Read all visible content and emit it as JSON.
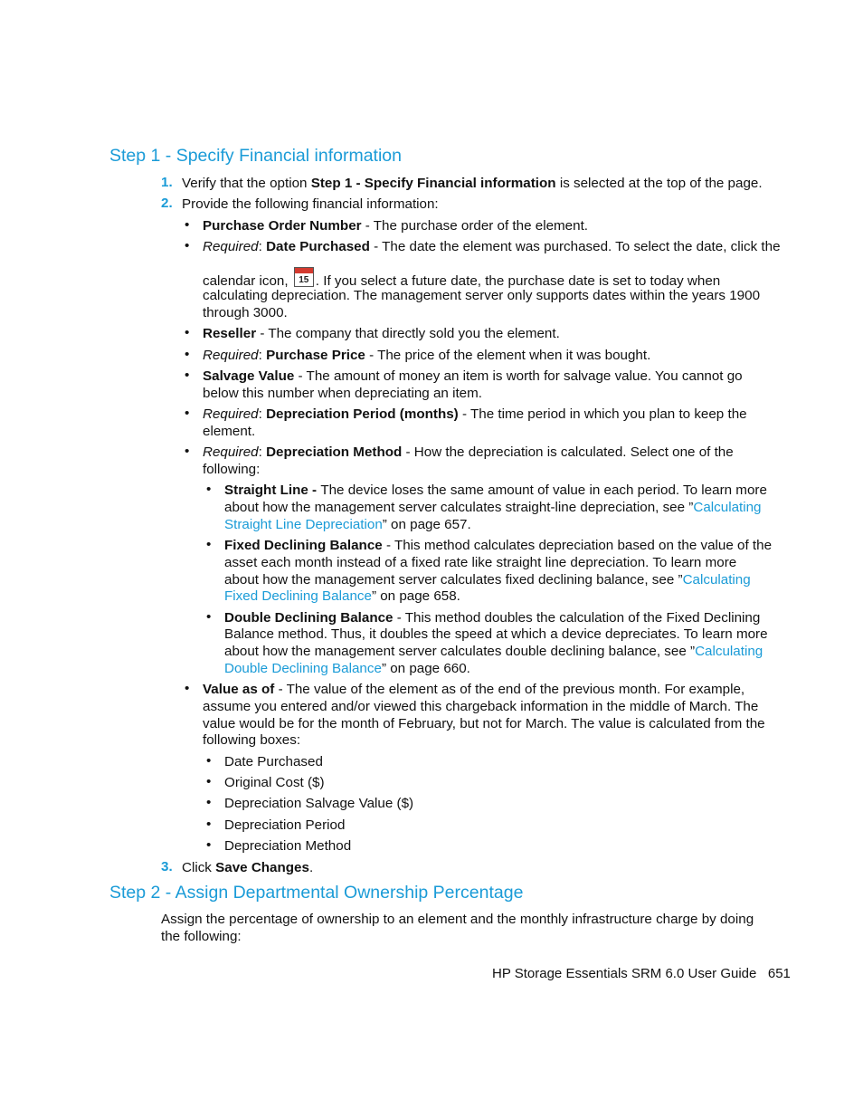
{
  "step1": {
    "heading": "Step 1 - Specify Financial information",
    "items": [
      {
        "num": "1.",
        "pre": "Verify that the option ",
        "bold": "Step 1 - Specify Financial information",
        "post": " is selected at the top of the page."
      },
      {
        "num": "2.",
        "text": "Provide the following financial information:"
      }
    ],
    "fields": {
      "po": {
        "bold": "Purchase Order Number",
        "text": " - The purchase order of the element."
      },
      "date": {
        "req": "Required",
        "bold": "Date Purchased",
        "text1": " - The date the element was purchased. To select the date, click the",
        "text2a": "calendar icon, ",
        "icon_day": "15",
        "text2b": ". If you select a future date, the purchase date is set to today when",
        "text3": "calculating depreciation. The management server only supports dates within the years 1900",
        "text4": "through 3000."
      },
      "reseller": {
        "bold": "Reseller",
        "text": " - The company that directly sold you the element."
      },
      "price": {
        "req": "Required",
        "bold": "Purchase Price",
        "text": " - The price of the element when it was bought."
      },
      "salvage": {
        "bold": "Salvage Value",
        "text1": " - The amount of money an item is worth for salvage value. You cannot go",
        "text2": "below this number when depreciating an item."
      },
      "period": {
        "req": "Required",
        "bold": "Depreciation Period (months)",
        "text1": " - The time period in which you plan to keep the",
        "text2": "element."
      },
      "method": {
        "req": "Required",
        "bold": "Depreciation Method",
        "text1": " - How the depreciation is calculated. Select one of the",
        "text2": "following:"
      }
    },
    "methods": {
      "straight": {
        "bold": "Straight Line - ",
        "l1": "The device loses the same amount of value in each period. To learn more",
        "l2a": "about how the management server calculates straight-line depreciation, see ”",
        "l2link": "Calculating",
        "l3link": "Straight Line Depreciation",
        "l3post": "” on page 657."
      },
      "fixed": {
        "bold": "Fixed Declining Balance",
        "l1": " - This method calculates depreciation based on the value of the",
        "l2": "asset each month instead of a fixed rate like straight line depreciation. To learn more",
        "l3a": "about how the management server calculates fixed declining balance, see ”",
        "l3link": "Calculating",
        "l4link": "Fixed Declining Balance",
        "l4post": "” on page 658."
      },
      "double": {
        "bold": "Double Declining Balance",
        "l1": " - This method doubles the calculation of the Fixed Declining",
        "l2": "Balance method. Thus, it doubles the speed at which a device depreciates. To learn more",
        "l3a": "about how the management server calculates double declining balance, see ”",
        "l3link": "Calculating",
        "l4link": "Double Declining Balance",
        "l4post": "” on page 660."
      }
    },
    "value_as_of": {
      "bold": "Value as of",
      "l1": " - The value of the element as of the end of the previous month. For example,",
      "l2": "assume you entered and/or viewed this chargeback information in the middle of March. The",
      "l3": "value would be for the month of February, but not for March. The value is calculated from the",
      "l4": "following boxes:"
    },
    "boxes": [
      "Date Purchased",
      "Original Cost ($)",
      "Depreciation Salvage Value ($)",
      "Depreciation Period",
      "Depreciation Method"
    ],
    "step3": {
      "num": "3.",
      "pre": "Click ",
      "bold": "Save Changes",
      "post": "."
    }
  },
  "step2": {
    "heading": "Step 2 - Assign Departmental Ownership Percentage",
    "l1": "Assign the percentage of ownership to an element and the monthly infrastructure charge by doing",
    "l2": "the following:"
  },
  "footer": {
    "title": "HP Storage Essentials SRM 6.0 User Guide",
    "page": "651"
  },
  "bullet": "•"
}
